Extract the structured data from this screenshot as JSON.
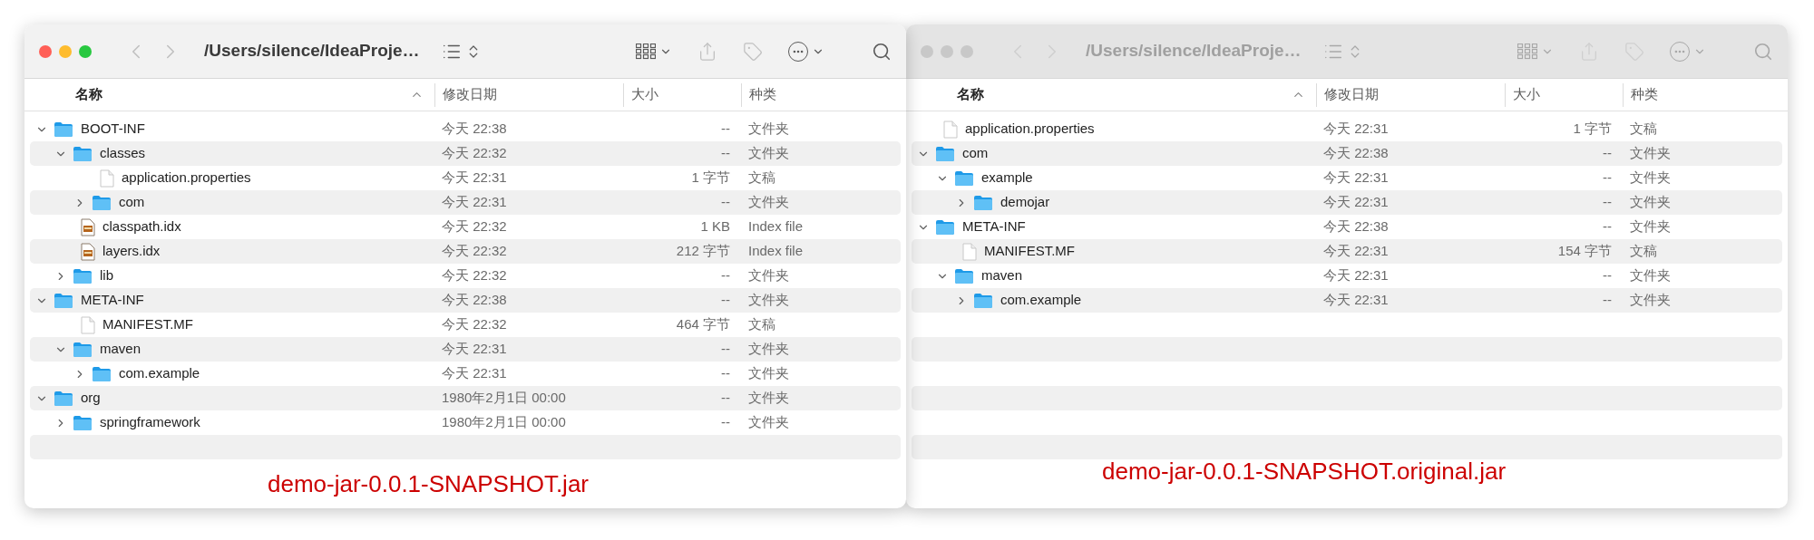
{
  "windows": [
    {
      "focused": true,
      "title": "/Users/silence/IdeaProje…",
      "columns": [
        {
          "label": "名称",
          "sorted": true
        },
        {
          "label": "修改日期",
          "sorted": false
        },
        {
          "label": "大小",
          "sorted": false
        },
        {
          "label": "种类",
          "sorted": false
        }
      ],
      "items": [
        {
          "kind": "folder",
          "name": "BOOT-INF",
          "date": "今天 22:38",
          "size": "--",
          "category": "文件夹",
          "expanded": true,
          "children": [
            {
              "kind": "folder",
              "name": "classes",
              "date": "今天 22:32",
              "size": "--",
              "category": "文件夹",
              "expanded": true,
              "children": [
                {
                  "kind": "document",
                  "name": "application.properties",
                  "date": "今天 22:31",
                  "size": "1 字节",
                  "category": "文稿"
                },
                {
                  "kind": "folder",
                  "name": "com",
                  "date": "今天 22:31",
                  "size": "--",
                  "category": "文件夹",
                  "expanded": false
                }
              ]
            },
            {
              "kind": "index",
              "name": "classpath.idx",
              "date": "今天 22:32",
              "size": "1 KB",
              "category": "Index file"
            },
            {
              "kind": "index",
              "name": "layers.idx",
              "date": "今天 22:32",
              "size": "212 字节",
              "category": "Index file"
            },
            {
              "kind": "folder",
              "name": "lib",
              "date": "今天 22:32",
              "size": "--",
              "category": "文件夹",
              "expanded": false
            }
          ]
        },
        {
          "kind": "folder",
          "name": "META-INF",
          "date": "今天 22:38",
          "size": "--",
          "category": "文件夹",
          "expanded": true,
          "children": [
            {
              "kind": "document",
              "name": "MANIFEST.MF",
              "date": "今天 22:32",
              "size": "464 字节",
              "category": "文稿"
            },
            {
              "kind": "folder",
              "name": "maven",
              "date": "今天 22:31",
              "size": "--",
              "category": "文件夹",
              "expanded": true,
              "children": [
                {
                  "kind": "folder",
                  "name": "com.example",
                  "date": "今天 22:31",
                  "size": "--",
                  "category": "文件夹",
                  "expanded": false
                }
              ]
            }
          ]
        },
        {
          "kind": "folder",
          "name": "org",
          "date": "1980年2月1日 00:00",
          "size": "--",
          "category": "文件夹",
          "expanded": true,
          "children": [
            {
              "kind": "folder",
              "name": "springframework",
              "date": "1980年2月1日 00:00",
              "size": "--",
              "category": "文件夹",
              "expanded": false
            }
          ]
        }
      ],
      "annotation": "demo-jar-0.0.1-SNAPSHOT.jar"
    },
    {
      "focused": false,
      "title": "/Users/silence/IdeaProje…",
      "columns": [
        {
          "label": "名称",
          "sorted": true
        },
        {
          "label": "修改日期",
          "sorted": false
        },
        {
          "label": "大小",
          "sorted": false
        },
        {
          "label": "种类",
          "sorted": false
        }
      ],
      "items": [
        {
          "kind": "document",
          "name": "application.properties",
          "date": "今天 22:31",
          "size": "1 字节",
          "category": "文稿"
        },
        {
          "kind": "folder",
          "name": "com",
          "date": "今天 22:38",
          "size": "--",
          "category": "文件夹",
          "expanded": true,
          "children": [
            {
              "kind": "folder",
              "name": "example",
              "date": "今天 22:31",
              "size": "--",
              "category": "文件夹",
              "expanded": true,
              "children": [
                {
                  "kind": "folder",
                  "name": "demojar",
                  "date": "今天 22:31",
                  "size": "--",
                  "category": "文件夹",
                  "expanded": false
                }
              ]
            }
          ]
        },
        {
          "kind": "folder",
          "name": "META-INF",
          "date": "今天 22:38",
          "size": "--",
          "category": "文件夹",
          "expanded": true,
          "children": [
            {
              "kind": "document",
              "name": "MANIFEST.MF",
              "date": "今天 22:31",
              "size": "154 字节",
              "category": "文稿"
            },
            {
              "kind": "folder",
              "name": "maven",
              "date": "今天 22:31",
              "size": "--",
              "category": "文件夹",
              "expanded": true,
              "children": [
                {
                  "kind": "folder",
                  "name": "com.example",
                  "date": "今天 22:31",
                  "size": "--",
                  "category": "文件夹",
                  "expanded": false
                }
              ]
            }
          ]
        }
      ],
      "annotation": "demo-jar-0.0.1-SNAPSHOT.original.jar"
    }
  ]
}
